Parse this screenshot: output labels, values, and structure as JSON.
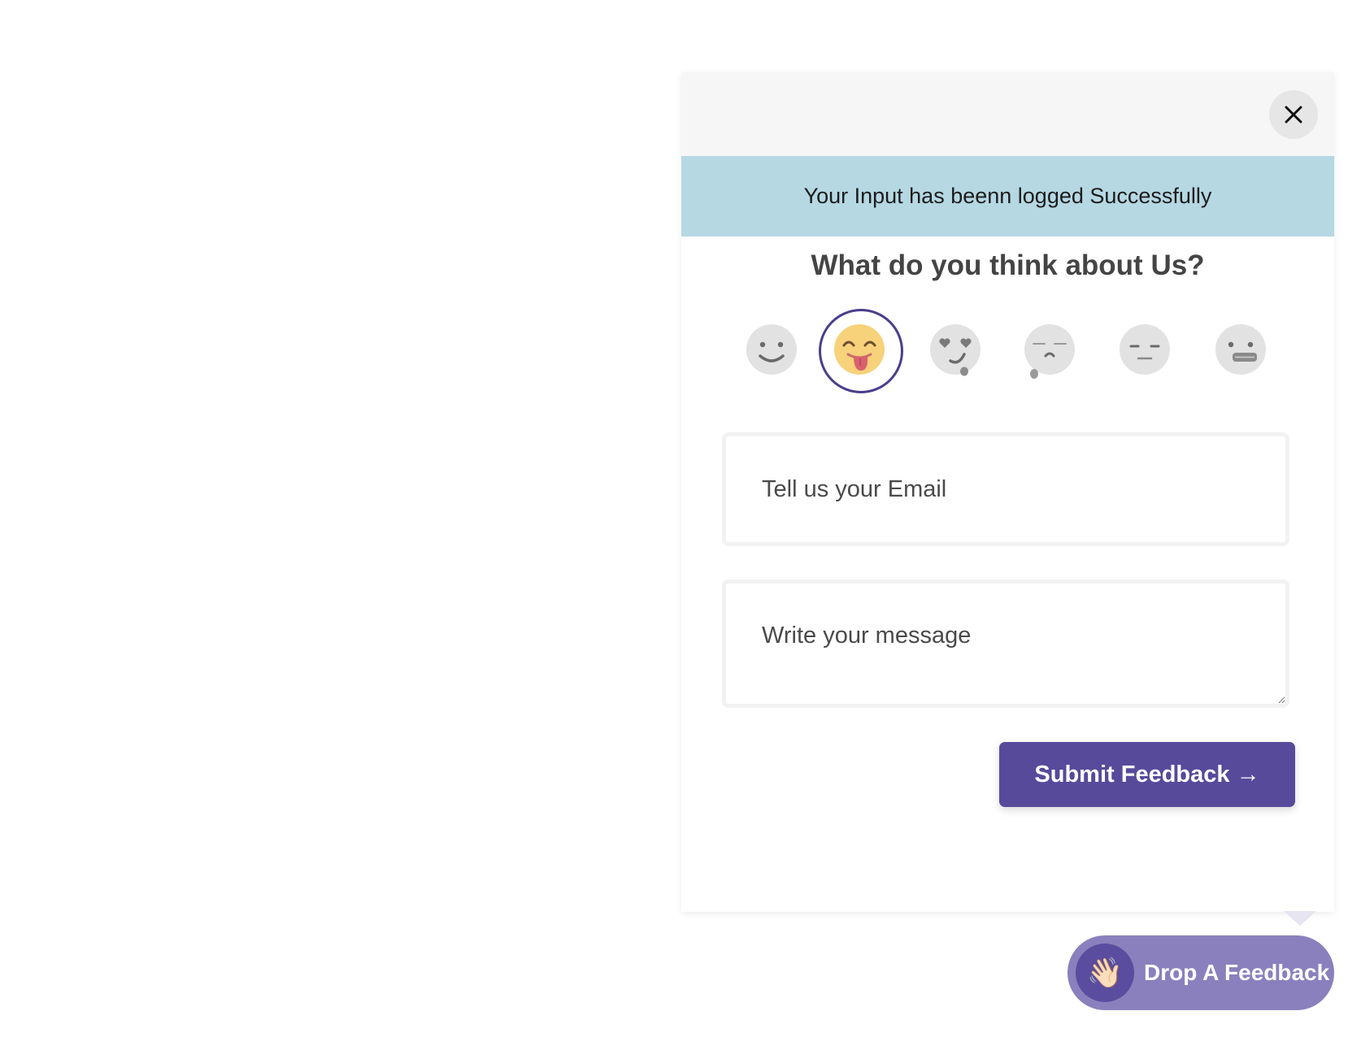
{
  "widget": {
    "close_icon": "close-icon",
    "banner_text": "Your Input has beenn logged Successfully",
    "question": "What do you think about Us?",
    "emojis": [
      {
        "name": "smile",
        "selected": false
      },
      {
        "name": "tongue-out",
        "selected": true
      },
      {
        "name": "heart-eyes",
        "selected": false
      },
      {
        "name": "sad-tear",
        "selected": false
      },
      {
        "name": "neutral",
        "selected": false
      },
      {
        "name": "grimace",
        "selected": false
      }
    ],
    "email_placeholder": "Tell us your Email",
    "message_placeholder": "Write your message",
    "submit_label": "Submit Feedback →"
  },
  "launcher": {
    "label": "Drop A Feedback",
    "icon": "👋🏻"
  },
  "colors": {
    "accent": "#574a9b",
    "banner": "#b5d8e3",
    "launcher": "#8a80bd"
  }
}
